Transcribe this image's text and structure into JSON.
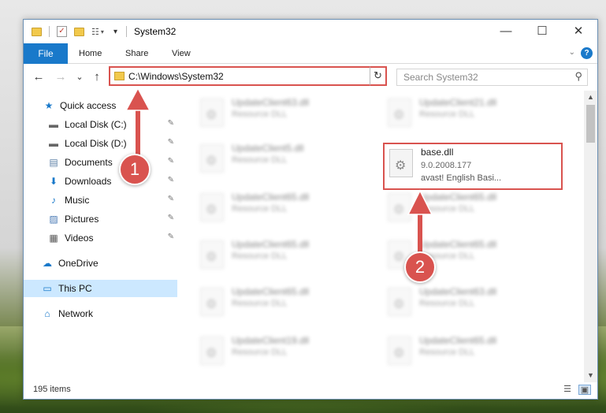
{
  "window": {
    "title": "System32",
    "min_glyph": "—",
    "max_glyph": "☐",
    "close_glyph": "✕"
  },
  "quick_access_toolbar": {
    "customize_glyph": "▾",
    "check_glyph": "✓"
  },
  "ribbon": {
    "tabs": [
      {
        "label": "File"
      },
      {
        "label": "Home"
      },
      {
        "label": "Share"
      },
      {
        "label": "View"
      }
    ],
    "expand_glyph": "⌄",
    "help_glyph": "?"
  },
  "nav_buttons": {
    "back_glyph": "←",
    "forward_glyph": "→",
    "recent_glyph": "⌄",
    "up_glyph": "↑"
  },
  "address": {
    "path": "C:\\Windows\\System32",
    "dropdown_glyph": "⌄",
    "refresh_glyph": "↻"
  },
  "search": {
    "placeholder": "Search System32",
    "icon_glyph": "⚲"
  },
  "sidebar": {
    "items": [
      {
        "label": "Quick access",
        "icon": "star-icon",
        "glyph": "★"
      },
      {
        "label": "Local Disk (C:)",
        "icon": "drive-icon",
        "glyph": "▬",
        "pinned": true
      },
      {
        "label": "Local Disk (D:)",
        "icon": "drive-icon",
        "glyph": "▬",
        "pinned": true
      },
      {
        "label": "Documents",
        "icon": "documents-icon",
        "glyph": "▤",
        "pinned": true
      },
      {
        "label": "Downloads",
        "icon": "download-icon",
        "glyph": "⬇",
        "pinned": true
      },
      {
        "label": "Music",
        "icon": "music-icon",
        "glyph": "♪",
        "pinned": true
      },
      {
        "label": "Pictures",
        "icon": "pictures-icon",
        "glyph": "▨",
        "pinned": true
      },
      {
        "label": "Videos",
        "icon": "videos-icon",
        "glyph": "▦",
        "pinned": true
      },
      {
        "label": "OneDrive",
        "icon": "cloud-icon",
        "glyph": "☁"
      },
      {
        "label": "This PC",
        "icon": "computer-icon",
        "glyph": "▭"
      },
      {
        "label": "Network",
        "icon": "network-icon",
        "glyph": "⌂"
      }
    ],
    "pin_glyph": "✎"
  },
  "files": [
    {
      "name": "UpdateClient63.dll",
      "desc": "Resource DLL"
    },
    {
      "name": "UpdateClient21.dll",
      "desc": "Resource DLL"
    },
    {
      "name": "UpdateClient5.dll",
      "desc": "Resource DLL"
    },
    {
      "name": "base.dll",
      "version": "9.0.2008.177",
      "desc": "avast! English Basi..."
    },
    {
      "name": "UpdateClient65.dll",
      "desc": "Resource DLL"
    },
    {
      "name": "UpdateClient65.dll",
      "desc": "Resource DLL"
    },
    {
      "name": "UpdateClient65.dll",
      "desc": "Resource DLL"
    },
    {
      "name": "UpdateClient65.dll",
      "desc": "Resource DLL"
    },
    {
      "name": "UpdateClient65.dll",
      "desc": "Resource DLL"
    },
    {
      "name": "UpdateClient63.dll",
      "desc": "Resource DLL"
    },
    {
      "name": "UpdateClient19.dll",
      "desc": "Resource DLL"
    },
    {
      "name": "UpdateClient65.dll",
      "desc": "Resource DLL"
    }
  ],
  "scrollbar": {
    "up_glyph": "▲",
    "down_glyph": "▼"
  },
  "status": {
    "item_count": "195 items",
    "details_view_glyph": "☰",
    "large_icons_glyph": "▣"
  },
  "annotations": {
    "step1": "1",
    "step2": "2",
    "color": "#d9534f"
  }
}
